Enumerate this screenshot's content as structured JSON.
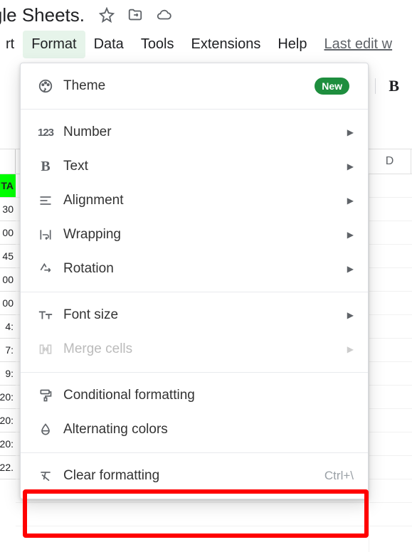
{
  "doc": {
    "title_visible": "oogle Sheets."
  },
  "menubar": {
    "items": [
      "rt",
      "Format",
      "Data",
      "Tools",
      "Extensions",
      "Help"
    ],
    "active_index": 1,
    "last_edit": "Last edit w"
  },
  "toolbar": {
    "bold": "B"
  },
  "column_header_visible": "D",
  "row_fragments": [
    "TA",
    "30",
    "00",
    "45",
    "00",
    "00",
    "4:",
    "7:",
    "9:",
    "20:",
    "20:",
    "20:",
    "22."
  ],
  "format_menu": {
    "theme": {
      "label": "Theme",
      "badge": "New"
    },
    "number": "Number",
    "text": "Text",
    "alignment": "Alignment",
    "wrapping": "Wrapping",
    "rotation": "Rotation",
    "font_size": "Font size",
    "merge": "Merge cells",
    "conditional": "Conditional formatting",
    "alternating": "Alternating colors",
    "clear": "Clear formatting",
    "clear_shortcut": "Ctrl+\\"
  }
}
